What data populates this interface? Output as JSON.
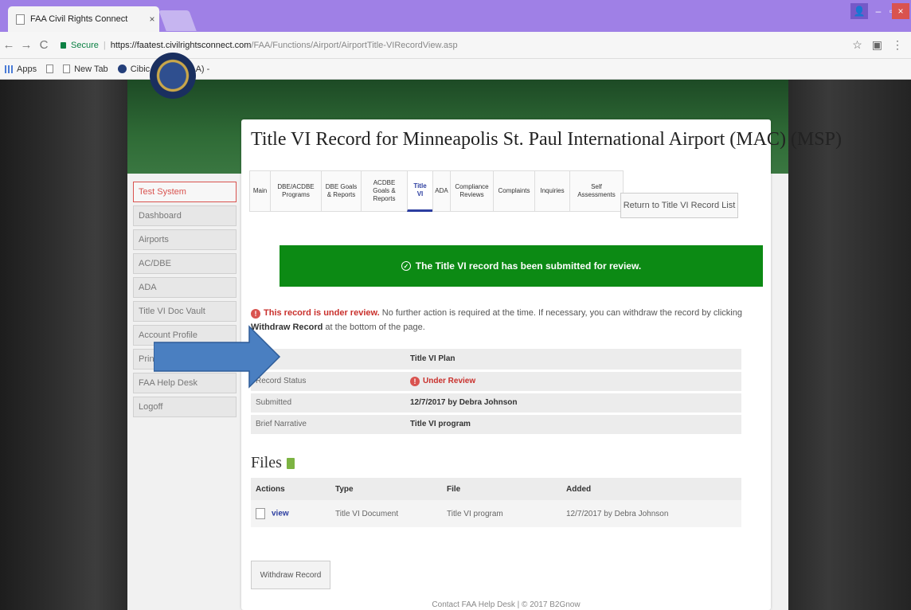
{
  "browser": {
    "tab_title": "FAA Civil Rights Connect",
    "tab_close": "×",
    "nav": {
      "back": "←",
      "forward": "→",
      "reload": "C"
    },
    "secure_label": "Secure",
    "url_host": "https://faatest.civilrightsconnect.com",
    "url_path": "/FAA/Functions/Airport/AirportTitle-VIRecordView.asp",
    "bookmarks": [
      "Apps",
      "New Tab",
      "Cibic, Nancy (FAA) -"
    ],
    "window": {
      "minimize": "–",
      "maximize": "▫",
      "close": "×"
    }
  },
  "sidebar": {
    "items": [
      {
        "label": "Test System"
      },
      {
        "label": "Dashboard"
      },
      {
        "label": "Airports"
      },
      {
        "label": "AC/DBE"
      },
      {
        "label": "ADA"
      },
      {
        "label": "Title VI Doc Vault"
      },
      {
        "label": "Account Profile"
      },
      {
        "label": "Print Page"
      },
      {
        "label": "FAA Help Desk"
      },
      {
        "label": "Logoff"
      }
    ]
  },
  "page": {
    "title": "Title VI Record for Minneapolis St. Paul International Airport (MAC) (MSP)"
  },
  "tabs": [
    {
      "label": "Main"
    },
    {
      "label": "DBE/ACDBE Programs"
    },
    {
      "label": "DBE Goals & Reports"
    },
    {
      "label": "ACDBE Goals & Reports"
    },
    {
      "label": "Title VI"
    },
    {
      "label": "ADA"
    },
    {
      "label": "Compliance Reviews"
    },
    {
      "label": "Complaints"
    },
    {
      "label": "Inquiries"
    },
    {
      "label": "Self Assessments"
    }
  ],
  "return_link": "Return to Title VI Record List",
  "success_message": "The Title VI record has been submitted for review.",
  "review_notice": {
    "highlight": "This record is under review.",
    "text": " No further action is required at the time. If necessary, you can withdraw the record by clicking ",
    "action": "Withdraw Record",
    "tail": " at the bottom of the page."
  },
  "details": [
    {
      "label": "Type",
      "value": "Title VI Plan"
    },
    {
      "label": "Record Status",
      "value": "Under Review"
    },
    {
      "label": "Submitted",
      "value": "12/7/2017 by Debra Johnson"
    },
    {
      "label": "Brief Narrative",
      "value": "Title VI program"
    }
  ],
  "files": {
    "heading": "Files",
    "columns": [
      "Actions",
      "Type",
      "File",
      "Added"
    ],
    "rows": [
      {
        "action": "view",
        "type": "Title VI Document",
        "file": "Title VI program",
        "added": "12/7/2017 by Debra Johnson"
      }
    ]
  },
  "withdraw_button": "Withdraw Record",
  "footer": "Contact FAA Help Desk | © 2017 B2Gnow",
  "colors": {
    "success": "#0c8a14",
    "warning": "#d9534f",
    "tab_accent": "#2c3ea0",
    "arrow": "#4a7fc1"
  }
}
